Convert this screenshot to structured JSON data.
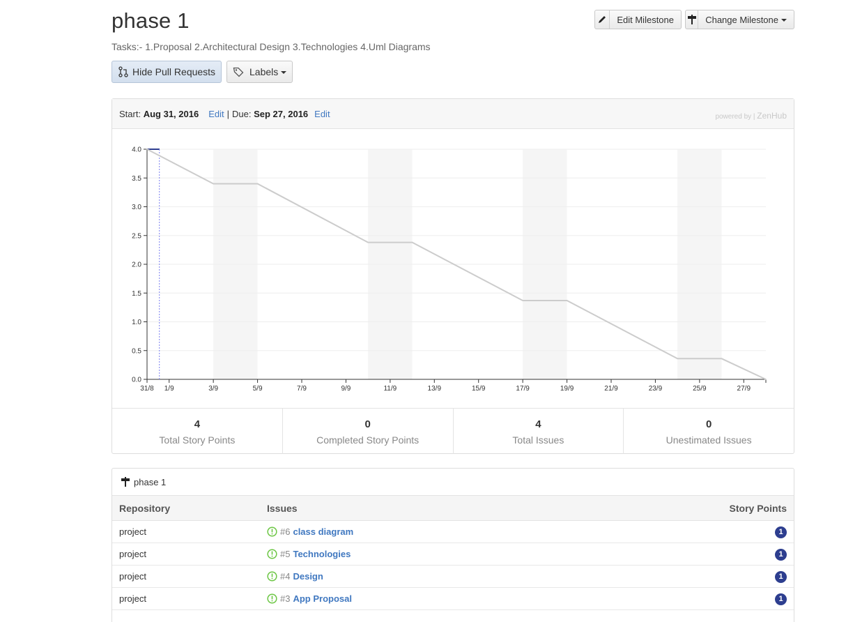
{
  "milestone": {
    "title": "phase 1",
    "description": "Tasks:- 1.Proposal 2.Architectural Design 3.Technologies 4.Uml Diagrams"
  },
  "toolbar": {
    "edit_label": "Edit Milestone",
    "change_label": "Change Milestone",
    "hide_pr_label": "Hide Pull Requests",
    "labels_label": "Labels"
  },
  "dates": {
    "start_label": "Start:",
    "start_value": "Aug 31, 2016",
    "edit1": "Edit",
    "sep": "|",
    "due_label": "Due:",
    "due_value": "Sep 27, 2016",
    "edit2": "Edit",
    "powered_by": "powered by |",
    "powered_brand": "ZenHub"
  },
  "chart_data": {
    "type": "line",
    "title": "",
    "xlabel": "",
    "ylabel": "",
    "x_ticks": [
      "31/8",
      "1/9",
      "3/9",
      "5/9",
      "7/9",
      "9/9",
      "11/9",
      "13/9",
      "15/9",
      "17/9",
      "19/9",
      "21/9",
      "23/9",
      "25/9",
      "27/9"
    ],
    "y_ticks": [
      "0.0",
      "0.5",
      "1.0",
      "1.5",
      "2.0",
      "2.5",
      "3.0",
      "3.5",
      "4.0"
    ],
    "ylim": [
      0,
      4
    ],
    "grid": true,
    "weekend_bands": [
      [
        "3/9",
        "5/9"
      ],
      [
        "10/9",
        "12/9"
      ],
      [
        "17/9",
        "19/9"
      ],
      [
        "24/9",
        "26/9"
      ]
    ],
    "series": [
      {
        "color": "#cccccc",
        "x": [
          "31/8",
          "3/9",
          "5/9",
          "10/9",
          "12/9",
          "17/9",
          "19/9",
          "24/9",
          "26/9",
          "28/9"
        ],
        "y": [
          4.0,
          3.4,
          3.4,
          2.38,
          2.38,
          1.37,
          1.37,
          0.36,
          0.36,
          0.0
        ]
      }
    ],
    "today_marker": "1/9"
  },
  "stats": [
    {
      "value": "4",
      "label": "Total Story Points"
    },
    {
      "value": "0",
      "label": "Completed Story Points"
    },
    {
      "value": "4",
      "label": "Total Issues"
    },
    {
      "value": "0",
      "label": "Unestimated Issues"
    }
  ],
  "issues_table": {
    "milestone": "phase 1",
    "headers": {
      "repository": "Repository",
      "issues": "Issues",
      "points": "Story Points"
    },
    "rows": [
      {
        "repo": "project",
        "number": "#6",
        "title": "class diagram",
        "points": "1"
      },
      {
        "repo": "project",
        "number": "#5",
        "title": "Technologies",
        "points": "1"
      },
      {
        "repo": "project",
        "number": "#4",
        "title": "Design",
        "points": "1"
      },
      {
        "repo": "project",
        "number": "#3",
        "title": "App Proposal",
        "points": "1"
      }
    ]
  },
  "colors": {
    "link": "#4078c0",
    "badge": "#2d3e8f",
    "open_issue": "#6cc644",
    "burndown_line": "#cccccc"
  }
}
